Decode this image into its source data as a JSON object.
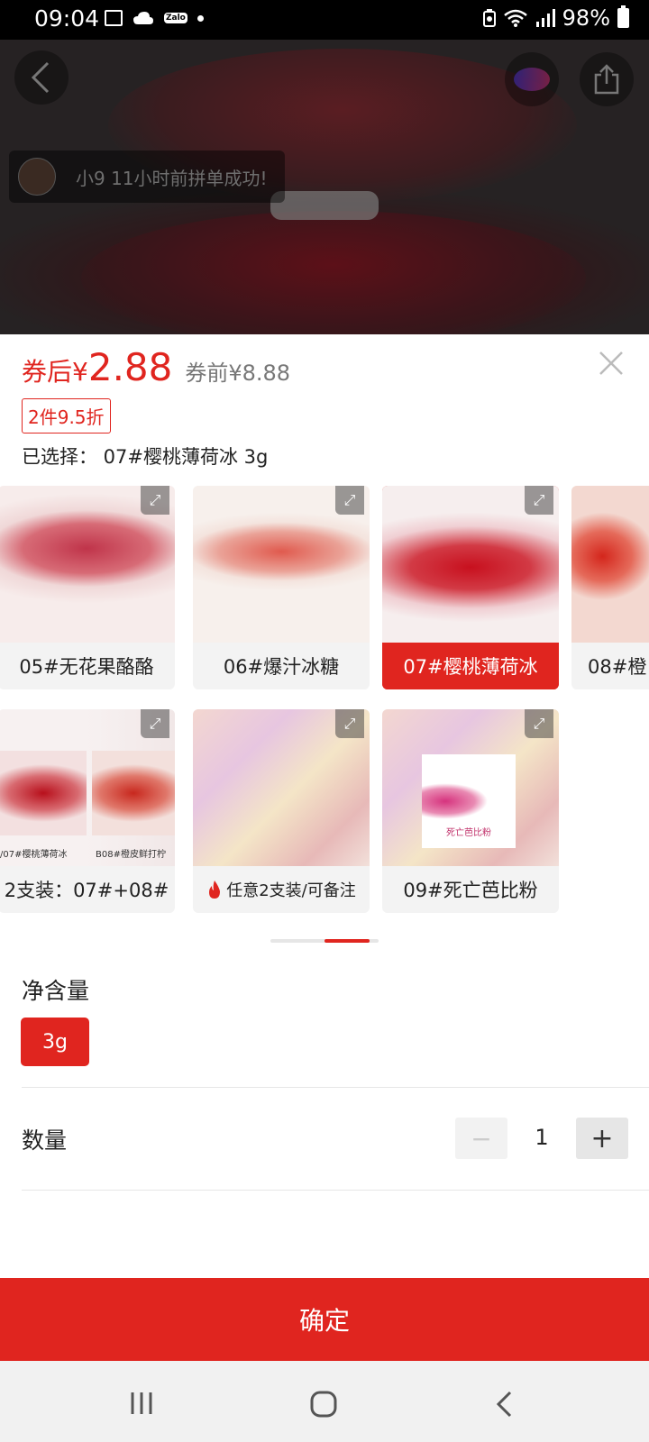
{
  "status_bar": {
    "time": "09:04",
    "battery": "98%",
    "icons": [
      "image-icon",
      "cloud-icon",
      "zalo-icon",
      "dot-icon",
      "battery-saver-icon",
      "wifi-icon",
      "signal-icon",
      "battery-icon"
    ],
    "zalo_label": "Zalo"
  },
  "hero": {
    "group_toast": "小9 11小时前拼单成功!"
  },
  "sheet": {
    "price_prefix": "券后",
    "currency": "¥",
    "price": "2.88",
    "original_price": "券前¥8.88",
    "discount_tag": "2件9.5折",
    "selected_text": "已选择： 07#樱桃薄荷冰 3g",
    "variants_row1": [
      {
        "label": "05#无花果酪酪",
        "selected": false
      },
      {
        "label": "06#爆汁冰糖",
        "selected": false
      },
      {
        "label": "07#樱桃薄荷冰",
        "selected": true
      },
      {
        "label": "08#橙",
        "selected": false
      }
    ],
    "variants_row2": [
      {
        "label": "2支装：07#+08#",
        "image_caption_left": "/07#樱桃薄荷冰",
        "image_caption_right": "B08#橙皮鲜打柠"
      },
      {
        "label": "任意2支装/可备注",
        "hot": true
      },
      {
        "label": "09#死亡芭比粉",
        "image_caption": "死亡芭比粉"
      }
    ],
    "size_section_title": "净含量",
    "size_option": "3g",
    "quantity_label": "数量",
    "quantity_minus": "−",
    "quantity_value": "1",
    "quantity_plus": "+",
    "confirm_label": "确定"
  },
  "colors": {
    "accent": "#e0251f",
    "status_bar": "#000000"
  }
}
